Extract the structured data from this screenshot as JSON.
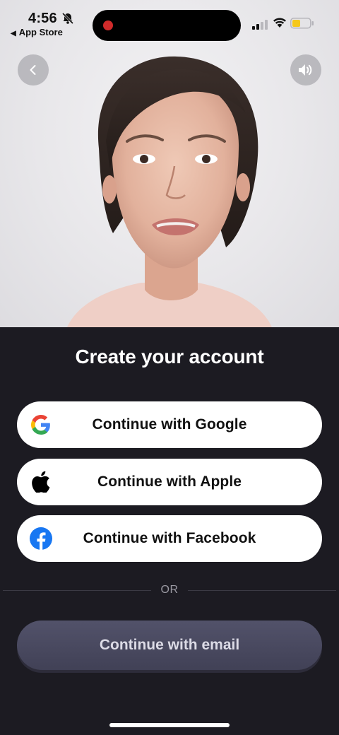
{
  "status_bar": {
    "time": "4:56",
    "back_label": "App Store",
    "icons": [
      "bell-slash-icon",
      "signal-icon",
      "wifi-icon",
      "battery-icon"
    ],
    "recording": true
  },
  "video": {
    "controls": {
      "back_icon": "chevron-left-icon",
      "sound_icon": "speaker-icon"
    }
  },
  "sheet": {
    "title": "Create your account",
    "buttons": [
      {
        "label": "Continue with Google",
        "icon": "google-icon"
      },
      {
        "label": "Continue with Apple",
        "icon": "apple-icon"
      },
      {
        "label": "Continue with Facebook",
        "icon": "facebook-icon"
      }
    ],
    "divider_text": "OR",
    "email_button": {
      "label": "Continue with email"
    }
  },
  "colors": {
    "background": "#1c1b22",
    "pill": "#ffffff",
    "email_button": "#4a4a60",
    "facebook_blue": "#1877f2",
    "record_red": "#d02b2b"
  }
}
